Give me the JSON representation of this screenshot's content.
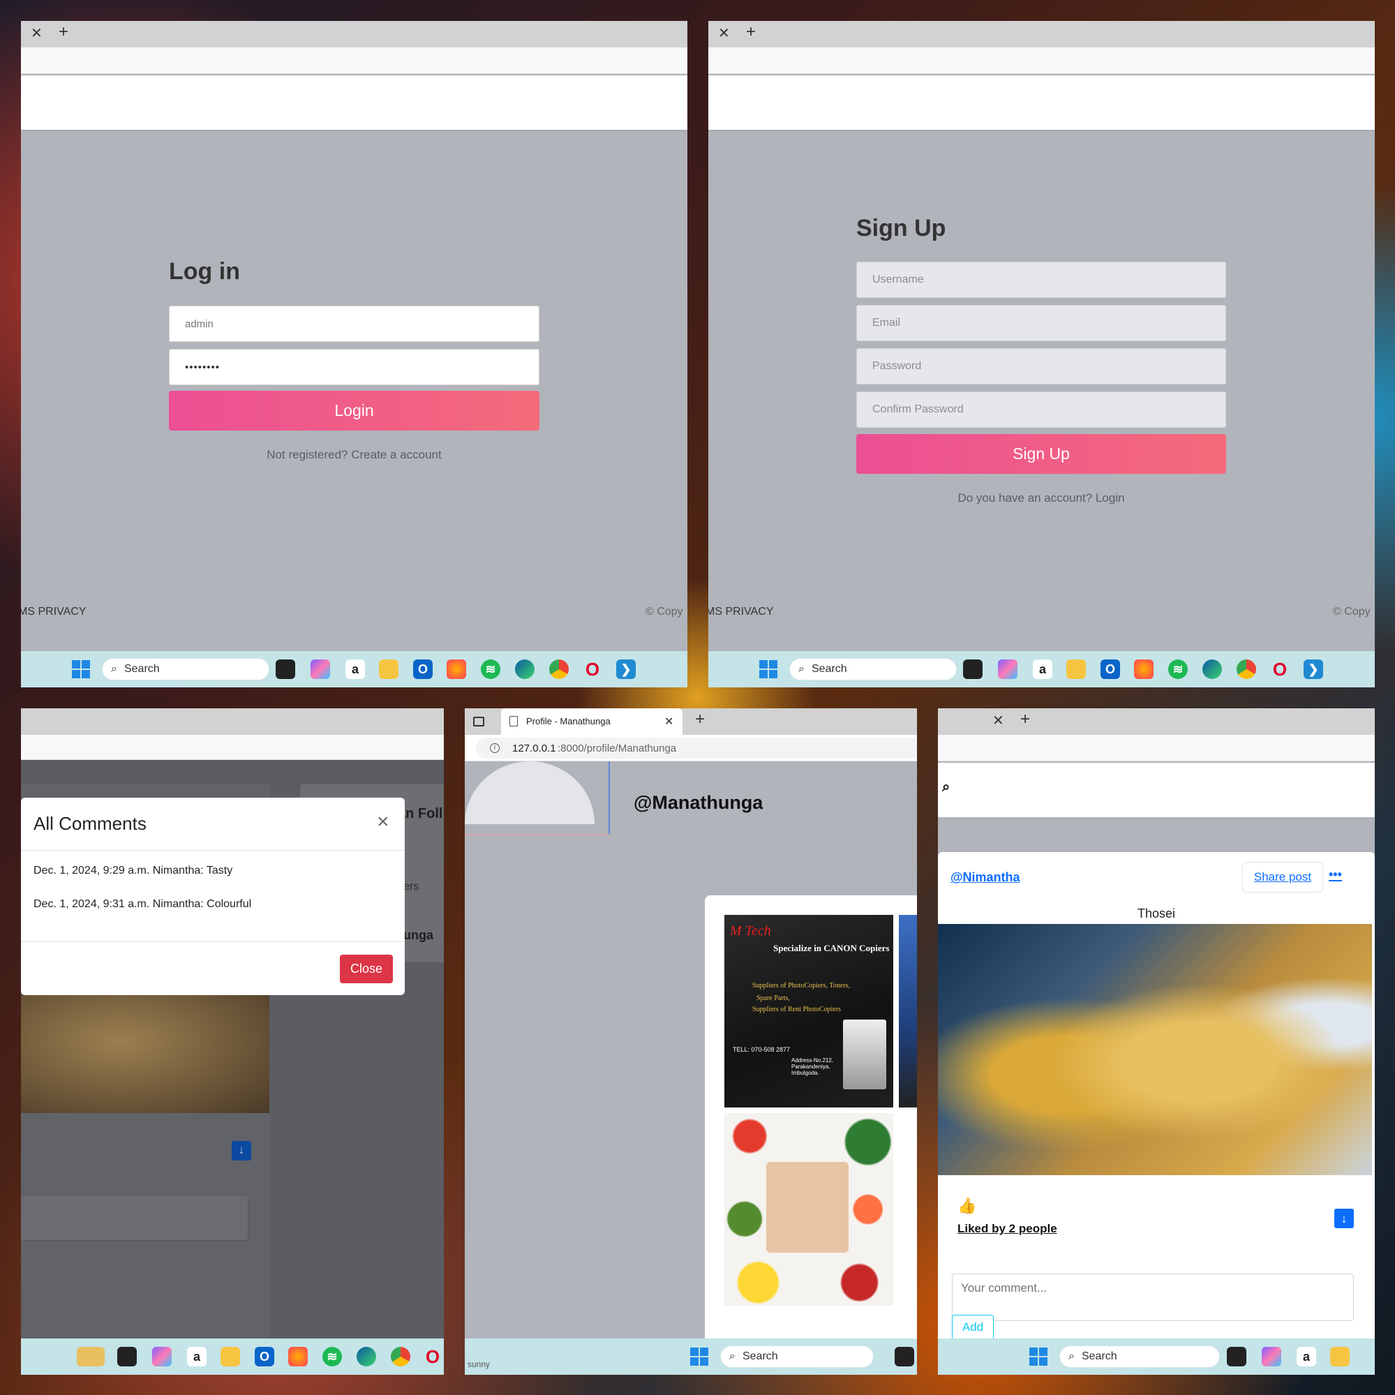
{
  "login": {
    "title": "Log in",
    "username_value": "admin",
    "password_value": "••••••••",
    "button": "Login",
    "link": "Not registered? Create a account",
    "footer_left": "MS  PRIVACY",
    "footer_right": "© Copy"
  },
  "signup": {
    "title": "Sign Up",
    "username_placeholder": "Username",
    "email_placeholder": "Email",
    "password_placeholder": "Password",
    "confirm_placeholder": "Confirm Password",
    "button": "Sign Up",
    "link": "Do you have an account? Login",
    "footer_left": "MS  PRIVACY",
    "footer_right": "© Copy"
  },
  "comments_modal": {
    "title": "All Comments",
    "comments": [
      "Dec. 1, 2024, 9:29 a.m. Nimantha: Tasty",
      "Dec. 1, 2024, 9:31 a.m. Nimantha: Colourful"
    ],
    "close_button": "Close",
    "bg_frag_1": "an Foll",
    "bg_frag_2": "ers",
    "bg_frag_3": "unga"
  },
  "profile": {
    "tab_title": "Profile - Manathunga",
    "url_host": "127.0.0.1",
    "url_path": ":8000/profile/Manathunga",
    "username": "@Manathunga",
    "status": "sunny",
    "ad_headline": "Specialize in CANON Copiers",
    "ad_logo": "M Tech",
    "ad_lines": [
      "Suppliers of PhotoCopiers, Toners,",
      "Spare Parts,",
      "Suppliers of Rent PhotoCopiers"
    ],
    "ad_tel": "TELL: 070-508 2877",
    "ad_address": "Address-No.212, Parakandeniya, Imbulgoda."
  },
  "post": {
    "author": "@Nimantha",
    "share_label": "Share post",
    "more_label": "•••",
    "title": "Thosei",
    "likes": "Liked by 2 people",
    "comment_placeholder": "Your comment...",
    "add_button": "Add"
  },
  "taskbar": {
    "search_label": "Search"
  },
  "colors": {
    "accent_pink": "#ec4f94",
    "danger_red": "#dc3545",
    "link_blue": "#0d6efd"
  }
}
